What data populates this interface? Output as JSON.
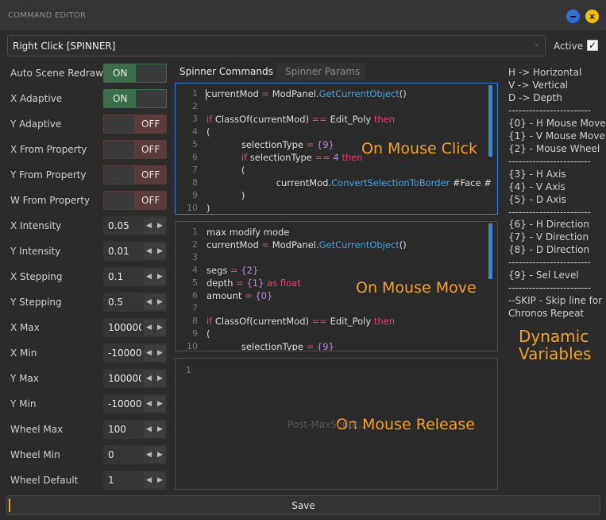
{
  "window": {
    "title": "COMMAND EDITOR",
    "minimize_icon": "minimize-icon",
    "close_label": "x"
  },
  "preset": {
    "value": "Right Click [SPINNER]"
  },
  "active": {
    "label": "Active",
    "checked": true,
    "check_glyph": "✓"
  },
  "props": {
    "auto_scene_redraw": {
      "label": "Auto Scene Redraw",
      "state": "ON"
    },
    "x_adaptive": {
      "label": "X Adaptive",
      "state": "ON"
    },
    "y_adaptive": {
      "label": "Y Adaptive",
      "state": "OFF"
    },
    "x_from_property": {
      "label": "X From Property",
      "state": "OFF"
    },
    "y_from_property": {
      "label": "Y From Property",
      "state": "OFF"
    },
    "w_from_property": {
      "label": "W From Property",
      "state": "OFF"
    },
    "x_intensity": {
      "label": "X Intensity",
      "value": "0.05"
    },
    "y_intensity": {
      "label": "Y Intensity",
      "value": "0.01"
    },
    "x_stepping": {
      "label": "X Stepping",
      "value": "0.1"
    },
    "y_stepping": {
      "label": "Y Stepping",
      "value": "0.5"
    },
    "x_max": {
      "label": "X Max",
      "value": "100000"
    },
    "x_min": {
      "label": "X Min",
      "value": "-100000"
    },
    "y_max": {
      "label": "Y Max",
      "value": "100000"
    },
    "y_min": {
      "label": "Y Min",
      "value": "-100000"
    },
    "wheel_max": {
      "label": "Wheel Max",
      "value": "100"
    },
    "wheel_min": {
      "label": "Wheel Min",
      "value": "0"
    },
    "wheel_default": {
      "label": "Wheel Default",
      "value": "1"
    }
  },
  "tabs": {
    "spinner_commands": "Spinner Commands",
    "spinner_params": "Spinner Params"
  },
  "editors": {
    "click": {
      "overlay": "On Mouse Click",
      "line_numbers": [
        "1",
        "2",
        "3",
        "4",
        "5",
        "6",
        "7",
        "8",
        "9",
        "10"
      ],
      "lines": [
        [
          "currentMod ",
          {
            "c": "kw",
            "t": "="
          },
          " ModPanel.",
          {
            "c": "fn",
            "t": "GetCurrentObject"
          },
          "()"
        ],
        [
          ""
        ],
        [
          {
            "c": "kw",
            "t": "if"
          },
          " ClassOf(currentMod) ",
          {
            "c": "kw",
            "t": "=="
          },
          " Edit_Poly ",
          {
            "c": "kw",
            "t": "then"
          }
        ],
        [
          "("
        ],
        [
          "            selectionType ",
          {
            "c": "kw",
            "t": "="
          },
          " ",
          {
            "c": "pp",
            "t": "{9}"
          }
        ],
        [
          "            ",
          {
            "c": "kw",
            "t": "if"
          },
          " selectionType ",
          {
            "c": "kw",
            "t": "=="
          },
          " ",
          {
            "c": "pp",
            "t": "4"
          },
          " ",
          {
            "c": "kw",
            "t": "then"
          }
        ],
        [
          "            ("
        ],
        [
          "                        currentMod.",
          {
            "c": "fn",
            "t": "ConvertSelectionToBorder"
          },
          " #Face #"
        ],
        [
          "            )"
        ],
        [
          ")"
        ]
      ]
    },
    "move": {
      "overlay": "On Mouse Move",
      "line_numbers": [
        "1",
        "2",
        "3",
        "4",
        "5",
        "6",
        "7",
        "8",
        "9",
        "10"
      ],
      "lines": [
        [
          "max modify mode"
        ],
        [
          "currentMod ",
          {
            "c": "kw",
            "t": "="
          },
          " ModPanel.",
          {
            "c": "fn",
            "t": "GetCurrentObject"
          },
          "()"
        ],
        [
          ""
        ],
        [
          "segs ",
          {
            "c": "kw",
            "t": "="
          },
          " ",
          {
            "c": "pp",
            "t": "{2}"
          }
        ],
        [
          "depth ",
          {
            "c": "kw",
            "t": "="
          },
          " ",
          {
            "c": "pp",
            "t": "{1}"
          },
          " ",
          {
            "c": "kw",
            "t": "as"
          },
          " ",
          {
            "c": "kw",
            "t": "float"
          }
        ],
        [
          "amount ",
          {
            "c": "kw",
            "t": "="
          },
          " ",
          {
            "c": "pp",
            "t": "{0}"
          }
        ],
        [
          ""
        ],
        [
          {
            "c": "kw",
            "t": "if"
          },
          " ClassOf(currentMod) ",
          {
            "c": "kw",
            "t": "=="
          },
          " Edit_Poly ",
          {
            "c": "kw",
            "t": "then"
          }
        ],
        [
          "("
        ],
        [
          "            selectionType ",
          {
            "c": "kw",
            "t": "="
          },
          " ",
          {
            "c": "pp",
            "t": "{9}"
          }
        ]
      ]
    },
    "release": {
      "overlay": "On Mouse Release",
      "line_numbers": [
        "1"
      ],
      "placeholder": "Post-MaxScript..."
    }
  },
  "legend": [
    "H -> Horizontal",
    "V -> Vertical",
    "D -> Depth",
    "------------------------",
    "{0} - H Mouse Move",
    "{1} - V Mouse Move",
    "{2} - Mouse Wheel",
    "------------------------",
    "{3} - H Axis",
    "{4} - V Axis",
    "{5} - D Axis",
    "------------------------",
    "{6} - H Direction",
    "{7} - V Direction",
    "{8} - D Direction",
    "------------------------",
    "{9} - Sel Level",
    "------------------------",
    "--SKIP - Skip line for",
    "Chronos Repeat"
  ],
  "dynamic_variables": {
    "line1": "Dynamic",
    "line2": "Variables"
  },
  "save": {
    "label": "Save"
  },
  "colors": {
    "accent": "#f5a21d",
    "on": "#3c6e4d",
    "off": "#5a3c3c",
    "focus": "#3c7bd6",
    "keyword": "#e5407a",
    "function": "#49a3d8",
    "placeholder": "#b98be0"
  }
}
